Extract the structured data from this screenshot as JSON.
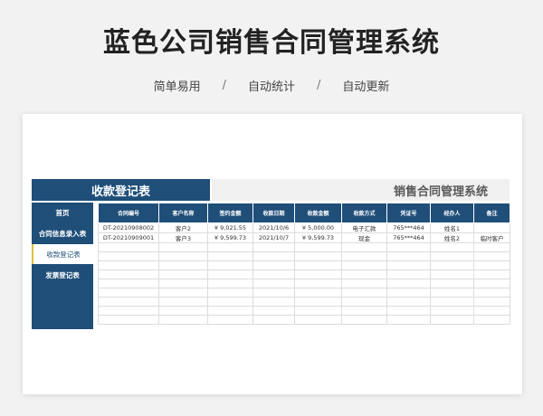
{
  "page": {
    "title": "蓝色公司销售合同管理系统",
    "features": [
      "简单易用",
      "自动统计",
      "自动更新"
    ],
    "separator": "/"
  },
  "sheet": {
    "header_left": "收款登记表",
    "header_right": "销售合同管理系统",
    "nav": [
      {
        "label": "首页",
        "active": false
      },
      {
        "label": "合同信息录入表",
        "active": false
      },
      {
        "label": "收款登记表",
        "active": true
      },
      {
        "label": "发票登记表",
        "active": false
      }
    ],
    "columns": [
      "合同编号",
      "客户名称",
      "签约金额",
      "收款日期",
      "收款金额",
      "收款方式",
      "凭证号",
      "经办人",
      "备注"
    ],
    "rows": [
      [
        "DT-20210908002",
        "客户2",
        "¥ 9,021.55",
        "2021/10/6",
        "¥ 5,000.00",
        "电子汇款",
        "765***464",
        "姓名1",
        ""
      ],
      [
        "DT-20210909001",
        "客户3",
        "¥ 9,599.73",
        "2021/10/7",
        "¥ 9,599.73",
        "现金",
        "765***464",
        "姓名2",
        "临时客户"
      ]
    ],
    "empty_row_count": 9
  }
}
